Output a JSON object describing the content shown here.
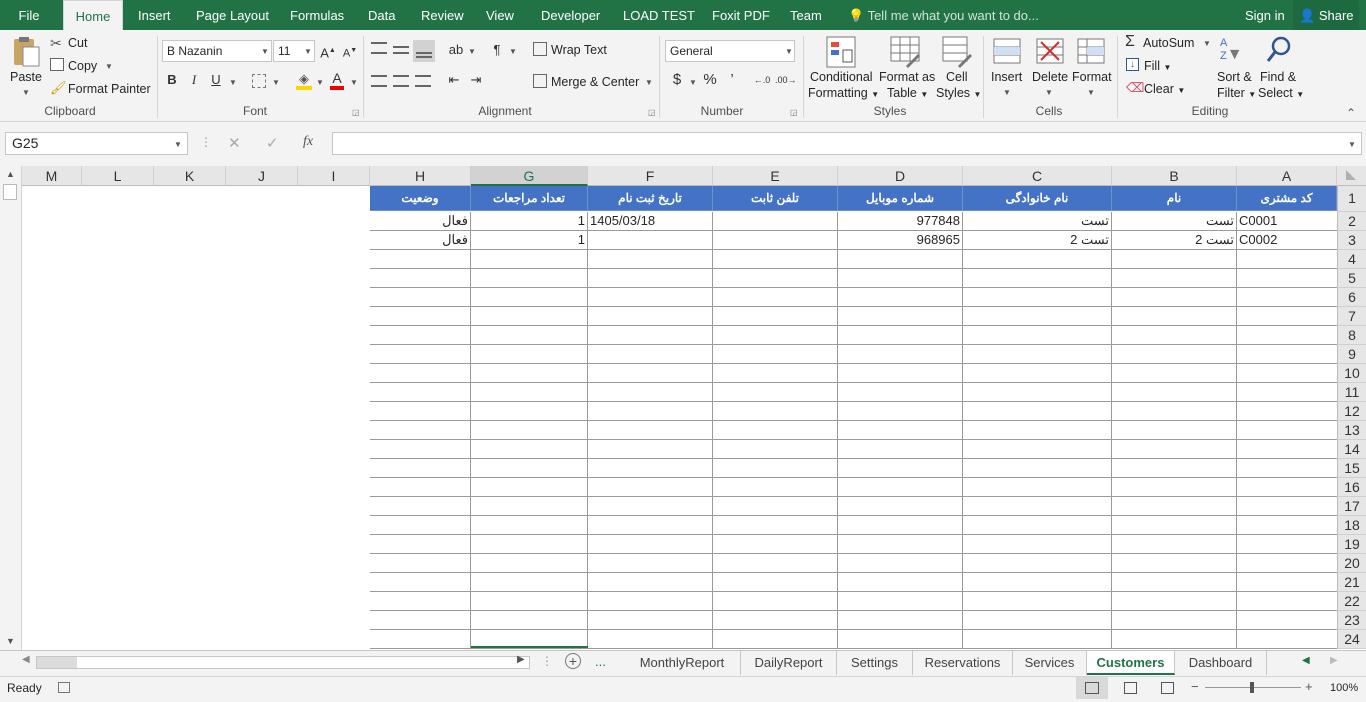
{
  "ribbon_tabs": [
    "File",
    "Home",
    "Insert",
    "Page Layout",
    "Formulas",
    "Data",
    "Review",
    "View",
    "Developer",
    "LOAD TEST",
    "Foxit PDF",
    "Team"
  ],
  "tell_me": "Tell me what you want to do...",
  "sign_in": "Sign in",
  "share": "Share",
  "clipboard": {
    "paste": "Paste",
    "cut": "Cut",
    "copy": "Copy",
    "format_painter": "Format Painter",
    "label": "Clipboard"
  },
  "font": {
    "name": "B Nazanin",
    "size": "11",
    "label": "Font",
    "bold": "B",
    "italic": "I",
    "underline": "U",
    "font_color_glyph": "A"
  },
  "alignment": {
    "wrap": "Wrap Text",
    "merge": "Merge & Center",
    "label": "Alignment"
  },
  "number": {
    "format": "General",
    "label": "Number",
    "currency": "$",
    "percent": "%",
    "comma": "’"
  },
  "styles": {
    "conditional": "Conditional",
    "formatting": "Formatting",
    "format_as": "Format as",
    "table": "Table",
    "cell": "Cell",
    "cell_styles": "Styles",
    "label": "Styles"
  },
  "cells": {
    "insert": "Insert",
    "delete": "Delete",
    "format": "Format",
    "label": "Cells"
  },
  "editing": {
    "autosum": "AutoSum",
    "fill": "Fill",
    "clear": "Clear",
    "sort": "Sort &",
    "filter": "Filter",
    "find": "Find &",
    "select": "Select",
    "label": "Editing"
  },
  "name_box": "G25",
  "formula_value": "",
  "columns": [
    "A",
    "B",
    "C",
    "D",
    "E",
    "F",
    "G",
    "H",
    "I",
    "J",
    "K",
    "L",
    "M"
  ],
  "headers": {
    "A": "کد مشتری",
    "B": "نام",
    "C": "نام خانوادگی",
    "D": "شماره موبایل",
    "E": "تلفن ثابت",
    "F": "تاریخ ثبت نام",
    "G": "تعداد مراجعات",
    "H": "وضعیت"
  },
  "rows": [
    {
      "A": "C0001",
      "B": "تست",
      "C": "تست",
      "D": "977848",
      "E": "",
      "F": "1405/03/18",
      "G": "1",
      "H": "فعال"
    },
    {
      "A": "C0002",
      "B": "تست 2",
      "C": "تست 2",
      "D": "968965",
      "E": "",
      "F": "",
      "G": "1",
      "H": "فعال"
    }
  ],
  "row_numbers": [
    "1",
    "2",
    "3",
    "4",
    "5",
    "6",
    "7",
    "8",
    "9",
    "10",
    "11",
    "12",
    "13",
    "14",
    "15",
    "16",
    "17",
    "18",
    "19",
    "20",
    "21",
    "22",
    "23",
    "24"
  ],
  "sheet_tabs": [
    "MonthlyReport",
    "DailyReport",
    "Settings",
    "Reservations",
    "Services",
    "Customers",
    "Dashboard"
  ],
  "active_sheet": "Customers",
  "more_tabs": "...",
  "status": "Ready",
  "zoom": "100%"
}
